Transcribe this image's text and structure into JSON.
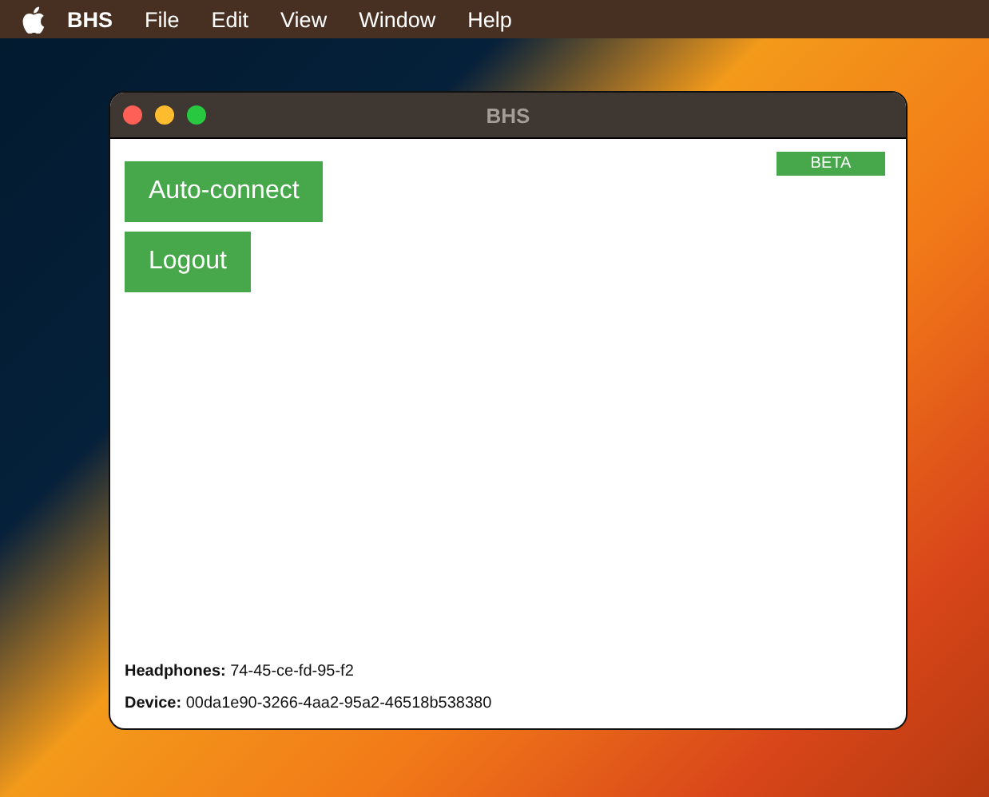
{
  "menu_bar": {
    "app_name": "BHS",
    "items": [
      "File",
      "Edit",
      "View",
      "Window",
      "Help"
    ]
  },
  "window": {
    "title": "BHS"
  },
  "badge": "BETA",
  "buttons": [
    "Auto-connect",
    "Logout"
  ],
  "info": [
    {
      "label": "Headphones:",
      "value": "74-45-ce-fd-95-f2"
    },
    {
      "label": "Device:",
      "value": "00da1e90-3266-4aa2-95a2-46518b538380"
    }
  ]
}
